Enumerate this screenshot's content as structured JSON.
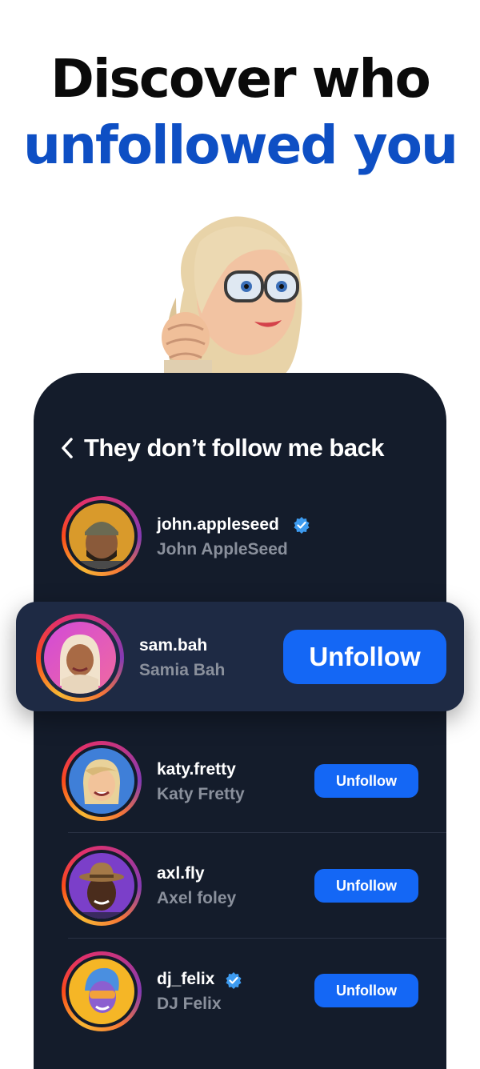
{
  "headline": {
    "line1": "Discover who",
    "line2": "unfollowed you"
  },
  "colors": {
    "accent_blue": "#1467f5",
    "headline_blue": "#0e4fc4",
    "panel_bg": "#141c2b",
    "card_bg": "#1e2a44"
  },
  "screen": {
    "title": "They don’t follow me back",
    "back_icon": "chevron-left-icon"
  },
  "users": [
    {
      "username": "john.appleseed",
      "name": "John AppleSeed",
      "verified": true
    },
    {
      "username": "sam.bah",
      "name": "Samia Bah",
      "verified": false,
      "button": "Unfollow"
    },
    {
      "username": "katy.fretty",
      "name": "Katy Fretty",
      "verified": false,
      "button": "Unfollow"
    },
    {
      "username": "axl.fly",
      "name": "Axel foley",
      "verified": false,
      "button": "Unfollow"
    },
    {
      "username": "dj_felix",
      "name": "DJ Felix",
      "verified": true,
      "button": "Unfollow"
    }
  ]
}
